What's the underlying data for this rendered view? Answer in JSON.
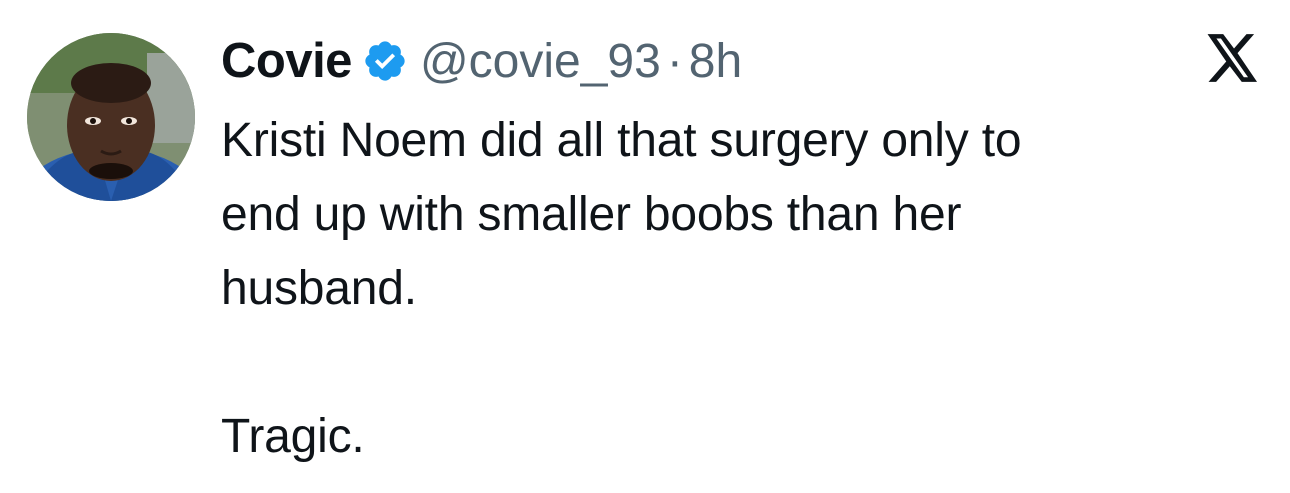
{
  "tweet": {
    "author": {
      "display_name": "Covie",
      "handle": "@covie_93",
      "verified": true,
      "avatar_icon": "profile-photo"
    },
    "separator": "·",
    "timestamp": "8h",
    "body_lines": [
      "Kristi Noem did all that surgery only to",
      "end up with smaller boobs than her",
      "husband.",
      "",
      "Tragic."
    ],
    "brand_icon": "x-logo-icon"
  },
  "colors": {
    "text_primary": "#0f1419",
    "text_secondary": "#536471",
    "verified_blue": "#1d9bf0",
    "background": "#ffffff"
  }
}
